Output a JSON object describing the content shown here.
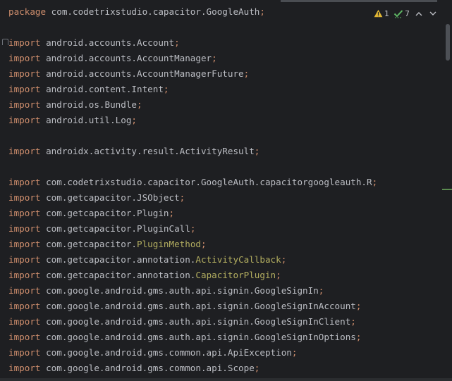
{
  "inspections": {
    "warnings_count": "1",
    "weak_warnings_count": "7"
  },
  "code": {
    "line_01": {
      "keyword": "package",
      "path": "com.codetrixstudio.capacitor.GoogleAuth",
      "semi": ";"
    },
    "line_03": {
      "keyword": "import",
      "path": "android.accounts.Account",
      "semi": ";"
    },
    "line_04": {
      "keyword": "import",
      "path": "android.accounts.AccountManager",
      "semi": ";"
    },
    "line_05": {
      "keyword": "import",
      "path": "android.accounts.AccountManagerFuture",
      "semi": ";"
    },
    "line_06": {
      "keyword": "import",
      "path": "android.content.Intent",
      "semi": ";"
    },
    "line_07": {
      "keyword": "import",
      "path": "android.os.Bundle",
      "semi": ";"
    },
    "line_08": {
      "keyword": "import",
      "path": "android.util.Log",
      "semi": ";"
    },
    "line_10": {
      "keyword": "import",
      "path": "androidx.activity.result.ActivityResult",
      "semi": ";"
    },
    "line_12": {
      "keyword": "import",
      "path": "com.codetrixstudio.capacitor.GoogleAuth.capacitorgoogleauth.R",
      "semi": ";"
    },
    "line_13": {
      "keyword": "import",
      "path": "com.getcapacitor.JSObject",
      "semi": ";"
    },
    "line_14": {
      "keyword": "import",
      "path": "com.getcapacitor.Plugin",
      "semi": ";"
    },
    "line_15": {
      "keyword": "import",
      "path": "com.getcapacitor.PluginCall",
      "semi": ";"
    },
    "line_16": {
      "keyword": "import",
      "path": "com.getcapacitor.",
      "annotation": "PluginMethod",
      "semi": ";"
    },
    "line_17": {
      "keyword": "import",
      "path": "com.getcapacitor.annotation.",
      "annotation": "ActivityCallback",
      "semi": ";"
    },
    "line_18": {
      "keyword": "import",
      "path": "com.getcapacitor.annotation.",
      "annotation": "CapacitorPlugin",
      "semi": ";"
    },
    "line_19": {
      "keyword": "import",
      "path": "com.google.android.gms.auth.api.signin.GoogleSignIn",
      "semi": ";"
    },
    "line_20": {
      "keyword": "import",
      "path": "com.google.android.gms.auth.api.signin.GoogleSignInAccount",
      "semi": ";"
    },
    "line_21": {
      "keyword": "import",
      "path": "com.google.android.gms.auth.api.signin.GoogleSignInClient",
      "semi": ";"
    },
    "line_22": {
      "keyword": "import",
      "path": "com.google.android.gms.auth.api.signin.GoogleSignInOptions",
      "semi": ";"
    },
    "line_23": {
      "keyword": "import",
      "path": "com.google.android.gms.common.api.ApiException",
      "semi": ";"
    },
    "line_24": {
      "keyword": "import",
      "path": "com.google.android.gms.common.api.Scope",
      "semi": ";"
    }
  },
  "colors": {
    "background": "#1e1f22",
    "keyword": "#cf8e6d",
    "annotation": "#b3ae60",
    "text": "#bcbec4",
    "warning": "#e0b534",
    "weak_warning": "#5fb865"
  },
  "icons": {
    "warning": "warning-triangle-icon",
    "weak_warning": "check-warning-icon",
    "previous": "chevron-up-icon",
    "next": "chevron-down-icon"
  }
}
